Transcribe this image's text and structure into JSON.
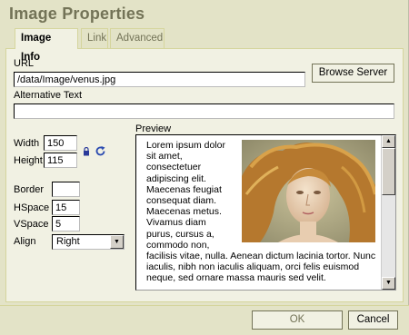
{
  "dialog": {
    "title": "Image Properties",
    "tabs": [
      {
        "label": "Image Info",
        "active": true
      },
      {
        "label": "Link",
        "active": false
      },
      {
        "label": "Advanced",
        "active": false
      }
    ]
  },
  "url": {
    "label": "URL",
    "value": "/data/Image/venus.jpg",
    "browse_label": "Browse Server"
  },
  "alt_text": {
    "label": "Alternative Text",
    "value": ""
  },
  "dimensions": {
    "width_label": "Width",
    "width_value": "150",
    "height_label": "Height",
    "height_value": "115",
    "lock_icon": "lock-icon",
    "reset_icon": "reset-size-icon"
  },
  "layout": {
    "border_label": "Border",
    "border_value": "",
    "hspace_label": "HSpace",
    "hspace_value": "15",
    "vspace_label": "VSpace",
    "vspace_value": "5",
    "align_label": "Align",
    "align_value": "Right"
  },
  "preview": {
    "label": "Preview",
    "text": "Lorem ipsum dolor sit amet, consectetuer adipiscing elit. Maecenas feugiat consequat diam. Maecenas metus. Vivamus diam purus, cursus a, commodo non, facilisis vitae, nulla. Aenean dictum lacinia tortor. Nunc iaculis, nibh non iaculis aliquam, orci felis euismod neque, sed ornare massa mauris sed velit."
  },
  "footer": {
    "ok_label": "OK",
    "cancel_label": "Cancel"
  },
  "colors": {
    "dialog_bg": "#e3e3c7",
    "panel_bg": "#f1f1e3",
    "title_color": "#737357"
  }
}
